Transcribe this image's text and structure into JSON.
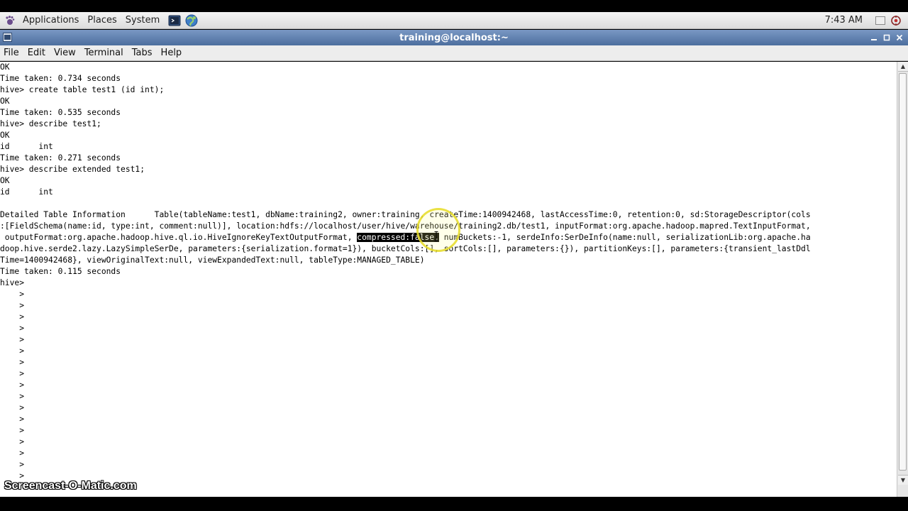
{
  "panel": {
    "menus": [
      "Applications",
      "Places",
      "System"
    ],
    "clock": "7:43 AM"
  },
  "window": {
    "title": "training@localhost:~",
    "controls": [
      "minimize",
      "maximize",
      "close"
    ]
  },
  "menubar": [
    "File",
    "Edit",
    "View",
    "Terminal",
    "Tabs",
    "Help"
  ],
  "terminal": {
    "lines": [
      "OK",
      "Time taken: 0.734 seconds",
      "hive> create table test1 (id int);",
      "OK",
      "Time taken: 0.535 seconds",
      "hive> describe test1;",
      "OK",
      "id      int",
      "Time taken: 0.271 seconds",
      "hive> describe extended test1;",
      "OK",
      "id      int",
      "",
      "Detailed Table Information      Table(tableName:test1, dbName:training2, owner:training, createTime:1400942468, lastAccessTime:0, retention:0, sd:StorageDescriptor(cols",
      ":[FieldSchema(name:id, type:int, comment:null)], location:hdfs://localhost/user/hive/warehouse/training2.db/test1, inputFormat:org.apache.hadoop.mapred.TextInputFormat,",
      "",
      "doop.hive.serde2.lazy.LazySimpleSerDe, parameters:{serialization.format=1}), bucketCols:[], sortCols:[], parameters:{}), partitionKeys:[], parameters:{transient_lastDdl",
      "Time=1400942468}, viewOriginalText:null, viewExpandedText:null, tableType:MANAGED_TABLE)",
      "Time taken: 0.115 seconds",
      "hive>",
      "    >",
      "    >",
      "    >",
      "    >",
      "    >",
      "    >",
      "    >",
      "    >",
      "    >",
      "    >",
      "    >",
      "    >",
      "    >",
      "    >",
      "    >",
      "    >",
      "    >"
    ],
    "selected_line": {
      "before": " outputFormat:org.apache.hadoop.hive.ql.io.HiveIgnoreKeyTextOutputFormat, ",
      "selected": "compressed:false,",
      "after": " numBuckets:-1, serdeInfo:SerDeInfo(name:null, serializationLib:org.apache.ha"
    }
  },
  "watermark": "Screencast-O-Matic.com"
}
